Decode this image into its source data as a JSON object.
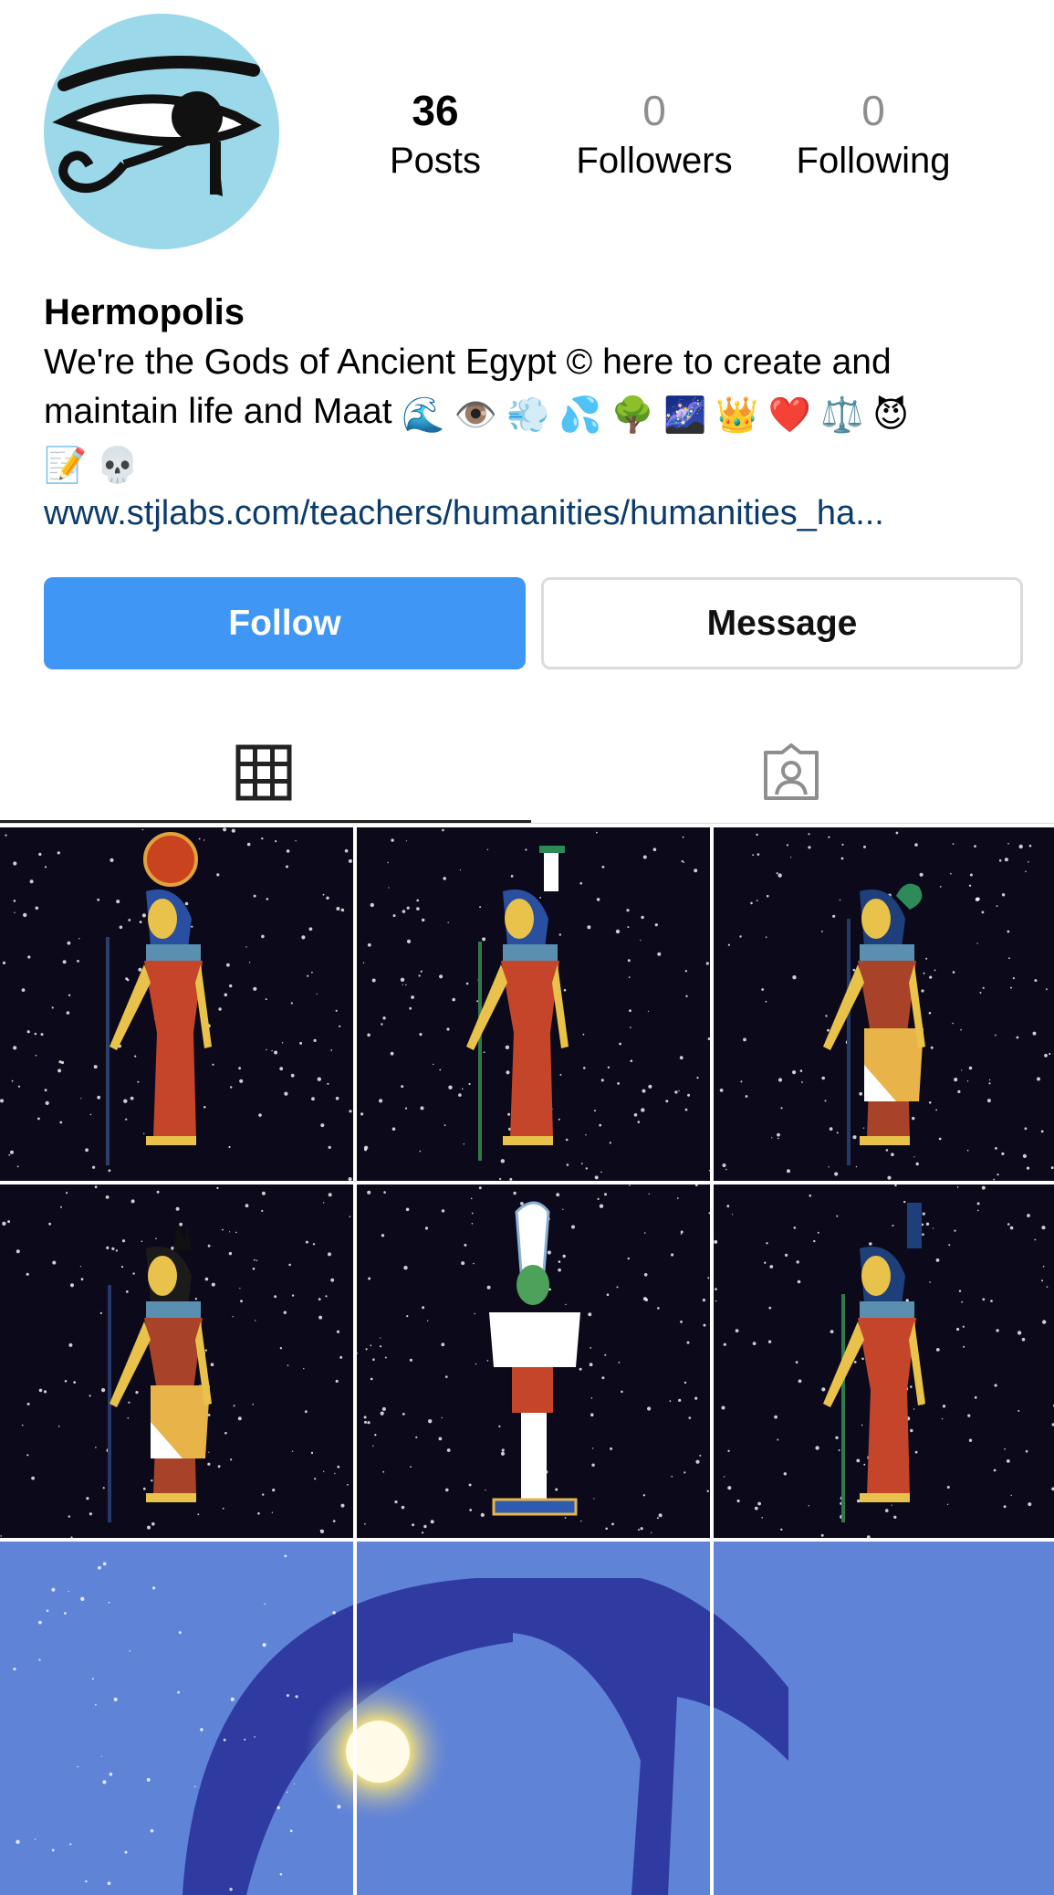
{
  "profile": {
    "username": "Hermopolis",
    "avatar_icon": "eye-of-horus-icon",
    "stats": {
      "posts": {
        "count": "36",
        "label": "Posts"
      },
      "followers": {
        "count": "0",
        "label": "Followers"
      },
      "following": {
        "count": "0",
        "label": "Following"
      }
    },
    "bio": {
      "line1": "We're the Gods of Ancient Egypt ©  here to create and",
      "line2_text": "maintain life and Maat",
      "line2_emojis": [
        "🌊",
        "👁️",
        "💨",
        "💦",
        "🌳",
        "🌌",
        "👑",
        "❤️",
        "⚖️",
        "😈"
      ],
      "line3_emojis": [
        "📝",
        "💀"
      ]
    },
    "link": "www.stjlabs.com/teachers/humanities/humanities_ha..."
  },
  "actions": {
    "follow_label": "Follow",
    "message_label": "Message"
  },
  "tabs": [
    {
      "icon": "grid-icon",
      "selected": true
    },
    {
      "icon": "tagged-person-icon",
      "selected": false
    }
  ],
  "posts": [
    {
      "subject": "goddess-sun-disk-crown"
    },
    {
      "subject": "goddess-feather-crown-staff"
    },
    {
      "subject": "god-serpent-headdress"
    },
    {
      "subject": "jackal-headed-god"
    },
    {
      "subject": "osiris-white-crown"
    },
    {
      "subject": "goddess-throne-crown-staff"
    },
    {
      "subject": "nut-sky-goddess-left"
    },
    {
      "subject": "nut-sky-goddess-center"
    },
    {
      "subject": "nut-sky-goddess-right"
    }
  ],
  "colors": {
    "follow_button": "#3f96f4",
    "avatar_background": "#9bd9ea",
    "link": "#0b3c6c",
    "muted_count": "#8e8e8e"
  }
}
